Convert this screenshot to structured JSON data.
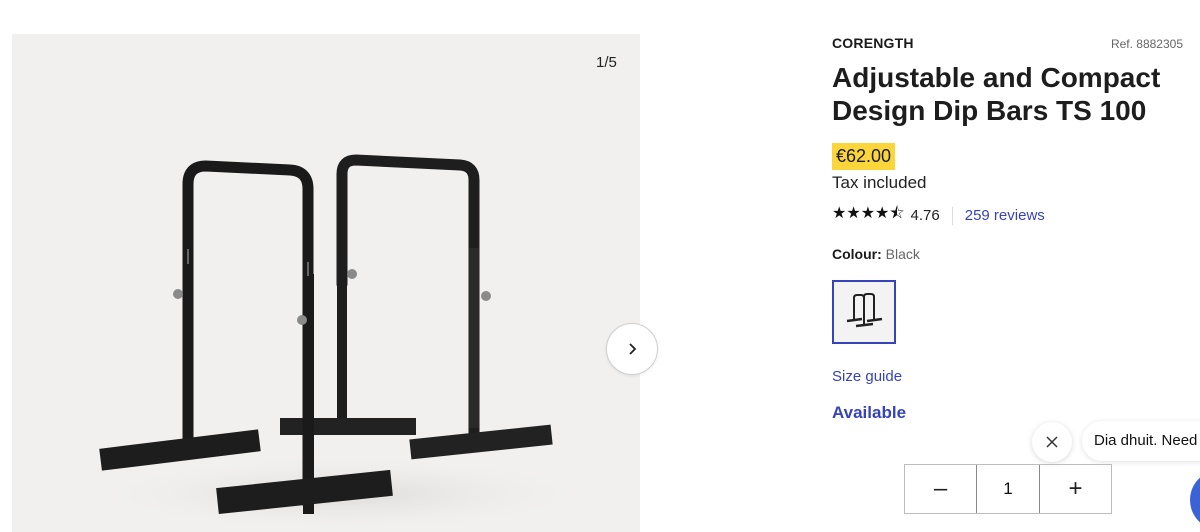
{
  "gallery": {
    "counter": "1/5",
    "image_alt": "Adjustable and Compact Design Dip Bars TS 100"
  },
  "product": {
    "brand": "CORENGTH",
    "ref": "Ref. 8882305",
    "title": "Adjustable and Compact Design Dip Bars TS 100",
    "price": "€62.00",
    "tax_note": "Tax included",
    "rating": {
      "stars": 4.76,
      "value_label": "4.76",
      "reviews_label": "259 reviews"
    },
    "colour": {
      "label": "Colour:",
      "value": "Black"
    },
    "size_guide": "Size guide",
    "availability": "Available"
  },
  "quantity": {
    "value": "1",
    "minus_label": "–",
    "plus_label": "+"
  },
  "chat": {
    "message": "Dia dhuit. Need"
  },
  "colors": {
    "accent": "#3643ba",
    "price_highlight": "#fbd63a",
    "chat_launcher": "#3a63d8"
  },
  "icons": {
    "next": "chevron-right-icon",
    "close": "close-icon",
    "star": "star-icon"
  }
}
